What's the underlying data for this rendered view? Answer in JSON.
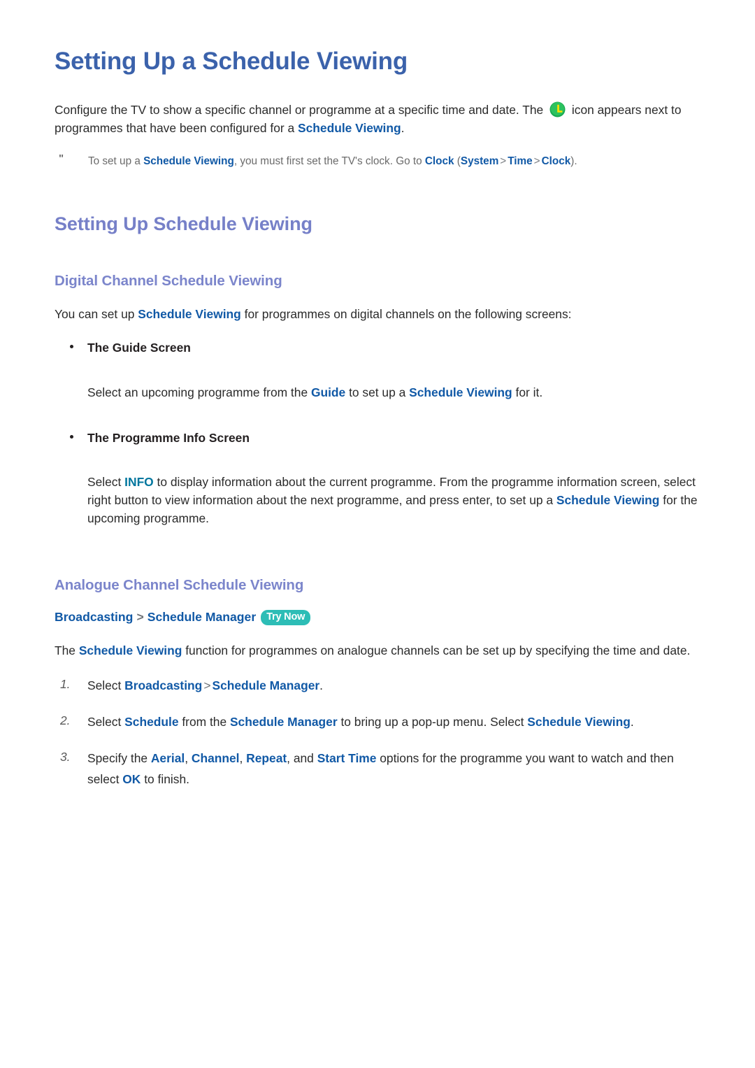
{
  "colors": {
    "title": "#3b62ab",
    "heading2": "#7680c8",
    "heading3": "#7b85cb",
    "link": "#1159a6",
    "key": "#00769e",
    "badge_bg": "#2dbdb6",
    "badge_text": "#ffffff",
    "icon_circle": "#18a951",
    "icon_hand": "#ffe100",
    "body_text": "#2b2b2b",
    "note_text": "#6b6b6b"
  },
  "page": {
    "title": "Setting Up a Schedule Viewing",
    "intro": {
      "part1": "Configure the TV to show a specific channel or programme at a specific time and date. The ",
      "icon_name": "schedule-viewing-icon",
      "part2": " icon appears next to programmes that have been configured for a ",
      "link": "Schedule Viewing",
      "part3": "."
    },
    "note": {
      "marker": "\"",
      "part1": "To set up a ",
      "link1": "Schedule Viewing",
      "part2": ", you must first set the TV's clock. Go to ",
      "link2": "Clock",
      "part3": " (",
      "link3": "System",
      "sep1": ">",
      "link4": "Time",
      "sep2": ">",
      "link5": "Clock",
      "part4": ")."
    },
    "section1": {
      "heading": "Setting Up Schedule Viewing",
      "sub1": {
        "heading": "Digital Channel Schedule Viewing",
        "intro": {
          "part1": "You can set up ",
          "link1": "Schedule Viewing",
          "part2": " for programmes on digital channels on the following screens:"
        },
        "bullets": [
          {
            "label": "The Guide Screen",
            "body": {
              "part1": "Select an upcoming programme from the ",
              "link1": "Guide",
              "part2": " to set up a ",
              "link2": "Schedule Viewing",
              "part3": " for it."
            }
          },
          {
            "label": "The Programme Info Screen",
            "body": {
              "part1": "Select ",
              "key1": "INFO",
              "part2": " to display information about the current programme. From the programme information screen, select right button to view information about the next programme, and press enter, to set up a ",
              "link1": "Schedule Viewing",
              "part3": " for the upcoming programme."
            }
          }
        ]
      },
      "sub2": {
        "heading": "Analogue Channel Schedule Viewing",
        "breadcrumb": {
          "item1": "Broadcasting",
          "sep": ">",
          "item2": "Schedule Manager",
          "badge": "Try Now"
        },
        "intro": {
          "part1": "The ",
          "link1": "Schedule Viewing",
          "part2": " function for programmes on analogue channels can be set up by specifying the time and date."
        },
        "steps": [
          {
            "number": "1.",
            "part1": "Select ",
            "link1": "Broadcasting",
            "sep1": ">",
            "link2": "Schedule Manager",
            "part2": "."
          },
          {
            "number": "2.",
            "part1": "Select ",
            "link1": "Schedule",
            "part2": " from the ",
            "link2": "Schedule Manager",
            "part3": " to bring up a pop-up menu. Select ",
            "link3": "Schedule Viewing",
            "part4": "."
          },
          {
            "number": "3.",
            "part1": "Specify the ",
            "link1": "Aerial",
            "part2": ", ",
            "link2": "Channel",
            "part3": ", ",
            "link3": "Repeat",
            "part4": ", and ",
            "link4": "Start Time",
            "part5": " options for the programme you want to watch and then select ",
            "link5": "OK",
            "part6": " to finish."
          }
        ]
      }
    }
  }
}
